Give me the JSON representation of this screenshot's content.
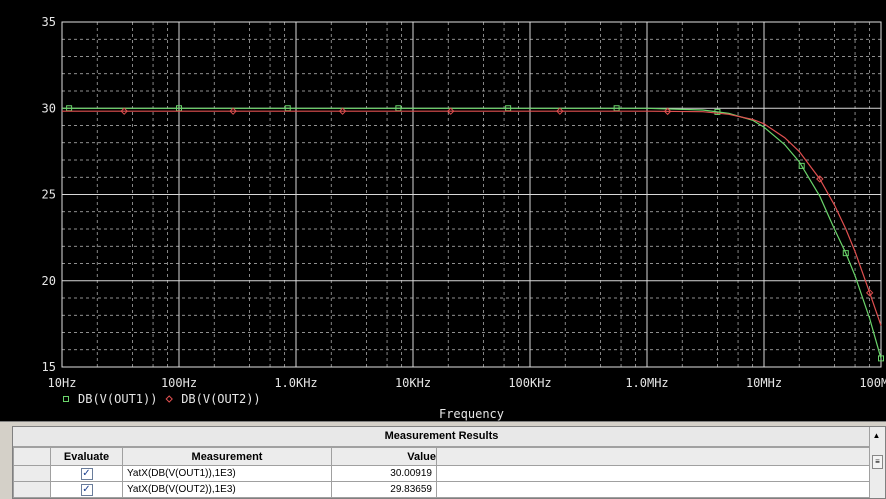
{
  "chart_data": {
    "type": "line",
    "xlabel": "Frequency",
    "xscale": "log",
    "xlim": [
      10,
      100000000
    ],
    "ylim": [
      15,
      35
    ],
    "grid": true,
    "x_ticks": [
      {
        "value": 10,
        "label": "10Hz"
      },
      {
        "value": 100,
        "label": "100Hz"
      },
      {
        "value": 1000,
        "label": "1.0KHz"
      },
      {
        "value": 10000,
        "label": "10KHz"
      },
      {
        "value": 100000,
        "label": "100KHz"
      },
      {
        "value": 1000000,
        "label": "1.0MHz"
      },
      {
        "value": 10000000,
        "label": "10MHz"
      },
      {
        "value": 100000000,
        "label": "100MHz"
      }
    ],
    "y_ticks": [
      {
        "value": 15,
        "label": "15"
      },
      {
        "value": 20,
        "label": "20"
      },
      {
        "value": 25,
        "label": "25"
      },
      {
        "value": 30,
        "label": "30"
      },
      {
        "value": 35,
        "label": "35"
      }
    ],
    "legend_position": "bottom-left",
    "series": [
      {
        "name": "DB(V(OUT1))",
        "color": "#6ad46a",
        "marker": "square",
        "x": [
          10,
          10000,
          1000000,
          3000000,
          5000000,
          8000000,
          10000000,
          15000000,
          20000000,
          30000000,
          40000000,
          50000000,
          60000000,
          80000000,
          100000000
        ],
        "y": [
          30.0,
          30.0,
          30.0,
          29.9,
          29.7,
          29.3,
          28.9,
          27.9,
          26.9,
          24.9,
          23.0,
          21.6,
          20.3,
          17.8,
          15.5
        ],
        "marker_x": [
          11.5,
          100,
          850,
          7500,
          65000,
          550000,
          4000000,
          21000000,
          50000000,
          100000000
        ]
      },
      {
        "name": "DB(V(OUT2))",
        "color": "#e05050",
        "marker": "diamond",
        "x": [
          10,
          10000,
          1000000,
          3000000,
          5000000,
          8000000,
          10000000,
          15000000,
          20000000,
          30000000,
          40000000,
          50000000,
          60000000,
          80000000,
          100000000
        ],
        "y": [
          29.83,
          29.83,
          29.83,
          29.8,
          29.65,
          29.35,
          29.1,
          28.3,
          27.5,
          25.9,
          24.4,
          23.0,
          21.7,
          19.3,
          17.4
        ],
        "marker_x": [
          34,
          290,
          2500,
          21000,
          180000,
          1500000,
          30000000,
          80000000
        ]
      }
    ]
  },
  "results": {
    "title": "Measurement Results",
    "headers": {
      "evaluate": "Evaluate",
      "measurement": "Measurement",
      "value": "Value"
    },
    "rows": [
      {
        "checked": "✓",
        "measurement": "YatX(DB(V(OUT1)),1E3)",
        "value": "30.00919"
      },
      {
        "checked": "✓",
        "measurement": "YatX(DB(V(OUT2)),1E3)",
        "value": "29.83659"
      }
    ]
  }
}
